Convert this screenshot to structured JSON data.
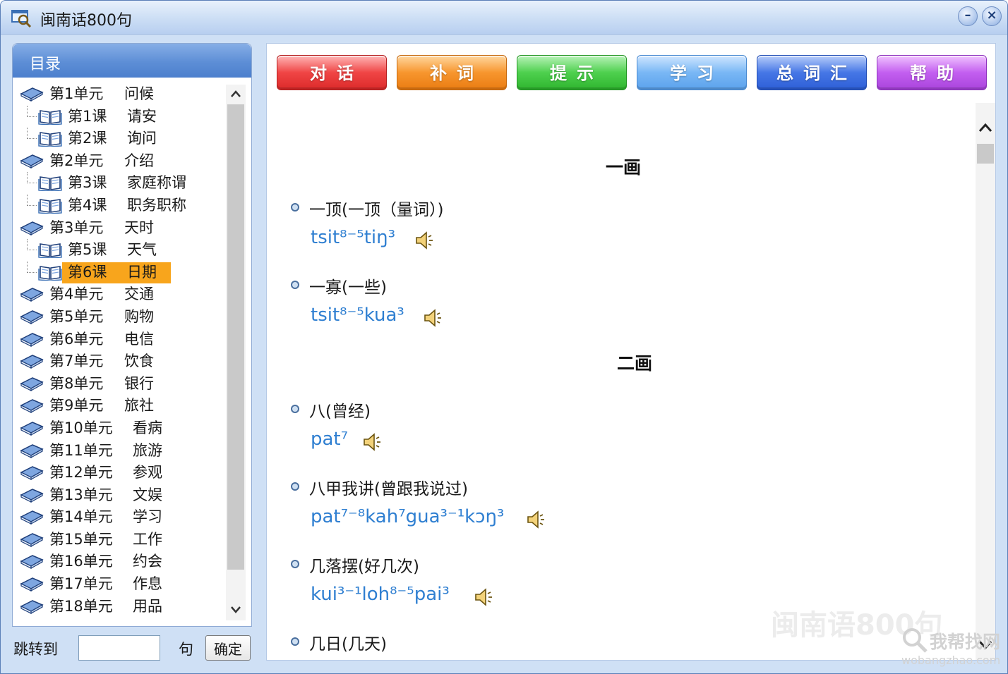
{
  "window": {
    "title": "闽南话800句"
  },
  "sidebar": {
    "header": "目录",
    "tree": [
      {
        "type": "unit",
        "a": "第1单元",
        "b": "问候"
      },
      {
        "type": "lesson",
        "a": "第1课",
        "b": "请安"
      },
      {
        "type": "lesson",
        "a": "第2课",
        "b": "询问"
      },
      {
        "type": "unit",
        "a": "第2单元",
        "b": "介绍"
      },
      {
        "type": "lesson",
        "a": "第3课",
        "b": "家庭称谓"
      },
      {
        "type": "lesson",
        "a": "第4课",
        "b": "职务职称"
      },
      {
        "type": "unit",
        "a": "第3单元",
        "b": "天时"
      },
      {
        "type": "lesson",
        "a": "第5课",
        "b": "天气"
      },
      {
        "type": "lesson",
        "a": "第6课",
        "b": "日期",
        "selected": true
      },
      {
        "type": "unit",
        "a": "第4单元",
        "b": "交通"
      },
      {
        "type": "unit",
        "a": "第5单元",
        "b": "购物"
      },
      {
        "type": "unit",
        "a": "第6单元",
        "b": "电信"
      },
      {
        "type": "unit",
        "a": "第7单元",
        "b": "饮食"
      },
      {
        "type": "unit",
        "a": "第8单元",
        "b": "银行"
      },
      {
        "type": "unit",
        "a": "第9单元",
        "b": "旅社"
      },
      {
        "type": "unit",
        "a": "第10单元",
        "b": "看病"
      },
      {
        "type": "unit",
        "a": "第11单元",
        "b": "旅游"
      },
      {
        "type": "unit",
        "a": "第12单元",
        "b": "参观"
      },
      {
        "type": "unit",
        "a": "第13单元",
        "b": "文娱"
      },
      {
        "type": "unit",
        "a": "第14单元",
        "b": "学习"
      },
      {
        "type": "unit",
        "a": "第15单元",
        "b": "工作"
      },
      {
        "type": "unit",
        "a": "第16单元",
        "b": "约会"
      },
      {
        "type": "unit",
        "a": "第17单元",
        "b": "作息"
      },
      {
        "type": "unit",
        "a": "第18单元",
        "b": "用品"
      }
    ],
    "scroll_up": "▲",
    "scroll_down": "▼"
  },
  "jump": {
    "label": "跳转到",
    "input_value": "",
    "unit": "句",
    "confirm": "确定"
  },
  "tabs": [
    {
      "id": "tab-dialogue",
      "label": "对话"
    },
    {
      "id": "tab-supplementary",
      "label": "补词"
    },
    {
      "id": "tab-hints",
      "label": "提示"
    },
    {
      "id": "tab-study",
      "label": "学习"
    },
    {
      "id": "tab-vocabulary",
      "label": "总词汇"
    },
    {
      "id": "tab-help",
      "label": "帮助"
    }
  ],
  "content": {
    "sections": [
      {
        "heading": "一画",
        "entries": [
          {
            "word": "一顶(一顶（量词）)",
            "roman": "tsit⁸⁻⁵tiŋ³"
          },
          {
            "word": "一寡(一些)",
            "roman": "tsit⁸⁻⁵kua³"
          }
        ]
      },
      {
        "heading": "二画",
        "entries": [
          {
            "word": "八(曾经)",
            "roman": "pat⁷"
          },
          {
            "word": "八甲我讲(曾跟我说过)",
            "roman": "pat⁷⁻⁸kah⁷gua³⁻¹kɔŋ³"
          },
          {
            "word": "几落摆(好几次)",
            "roman": "kui³⁻¹loh⁸⁻⁵pai³"
          },
          {
            "word": "几日(几天)",
            "roman": ""
          }
        ]
      }
    ],
    "scroll_up": "⌃",
    "scroll_down": "⌄"
  },
  "watermark": "闽南语800句",
  "site_watermark": {
    "text": "我帮找网",
    "url": "wobangzhao.com"
  },
  "icons": {
    "app": "app-search-icon",
    "unit": "closed-book-icon",
    "lesson": "open-book-icon",
    "speaker": "speaker-icon"
  },
  "colors": {
    "selection": "#f8a51c",
    "romanization": "#2f7fd1",
    "sidebar_header": "#5d8ed6"
  }
}
